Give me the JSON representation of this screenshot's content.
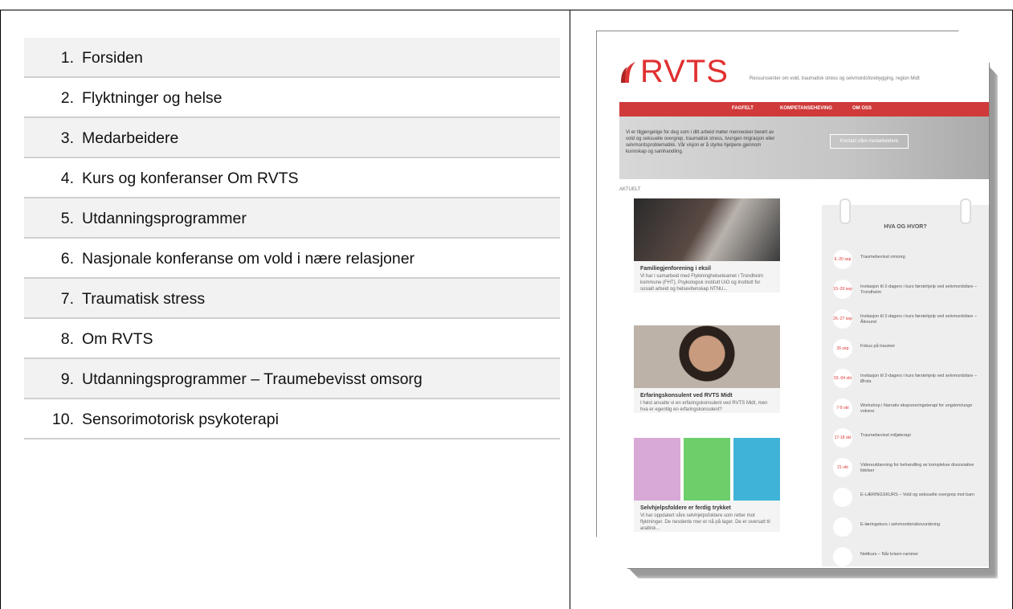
{
  "list": [
    {
      "num": "1.",
      "label": "Forsiden",
      "shade": true
    },
    {
      "num": "2.",
      "label": "Flyktninger og helse",
      "shade": false
    },
    {
      "num": "3.",
      "label": "Medarbeidere",
      "shade": true
    },
    {
      "num": "4.",
      "label": "Kurs og konferanser Om RVTS",
      "shade": false
    },
    {
      "num": "5.",
      "label": "Utdanningsprogrammer",
      "shade": true
    },
    {
      "num": "6.",
      "label": "Nasjonale konferanse om vold i nære relasjoner",
      "shade": false
    },
    {
      "num": "7.",
      "label": "Traumatisk stress",
      "shade": true
    },
    {
      "num": "8.",
      "label": "Om RVTS",
      "shade": false
    },
    {
      "num": "9.",
      "label": "Utdanningsprogrammer – Traumebevisst omsorg",
      "shade": true
    },
    {
      "num": "10.",
      "label": "Sensorimotorisk psykoterapi",
      "shade": false
    }
  ],
  "thumb": {
    "logo": "RVTS",
    "tagline": "Ressurssenter om vold, traumatisk stress og selvmordsforebygging, region Midt",
    "nav": [
      "FAGFELT",
      "KOMPETANSEHEVING",
      "OM OSS"
    ],
    "hero_text": "Vi er tilgjengelige for deg som i ditt arbeid møter mennesker berørt av vold og seksuelle overgrep, traumatisk stress, tvungen migrasjon eller selvmordsproblematikk. Vår visjon er å styrke hjelpere gjennom kunnskap og samhandling.",
    "hero_button": "Kontakt våre medarbeidere",
    "section": "AKTUELT",
    "cards": [
      {
        "title": "Familiegjenforening i eksil",
        "body": "Vi har i samarbeid med Flyktninghelseteamet i Trondheim kommune (FHT), Psykologisk institutt UiO og Institutt for sosialt arbeid og helsevitenskap NTNU..."
      },
      {
        "title": "Erfaringskonsulent ved RVTS Midt",
        "body": "I høst ansatte vi en erfaringskonsulent ved RVTS Midt, men hva er egentlig en erfaringskonsulent?"
      },
      {
        "title": "Selvhjelpsfoldere er ferdig trykket",
        "body": "Vi har oppdatert våre selvhjelpsfoldere som retter mot flyktninger. De nesdente mer er nå på lager. De er oversatt til arabisk..."
      }
    ],
    "cal_title": "HVA OG HVOR?",
    "events": [
      {
        "date": "6.-20 sep",
        "text": "Traumebevisst omsorg"
      },
      {
        "date": "19.-20 sep",
        "text": "Invitasjon til 2-dagers i kurs førstehjelp ved selvmordsfare – Trondheim"
      },
      {
        "date": "26.-27 sep",
        "text": "Invitasjon til 2-dagers i kurs førstehjelp ved selvmordsfare – Ålesund"
      },
      {
        "date": "26 sep",
        "text": "Fokus på traumer"
      },
      {
        "date": "03.-04 okt",
        "text": "Invitasjon til 2-dagers i kurs førstehjelp ved selvmordsfare – Ørsta"
      },
      {
        "date": "7-9 okt",
        "text": "Workshop i Narrativ eksponeringsterapi for ungdom/unge voksne"
      },
      {
        "date": "17-18 okt",
        "text": "Traumebevisst miljøterapi"
      },
      {
        "date": "21 okt",
        "text": "Videreutdanning for behandling av komplekse dissosiative lidelser"
      },
      {
        "date": "",
        "text": "E-LÆRINGSKURS – Vold og seksuelle overgrep mot barn"
      },
      {
        "date": "",
        "text": "E-læringskurs i selvmordsrisikovurdering"
      },
      {
        "date": "",
        "text": "Nettkurs – Når krisen rammer"
      }
    ]
  }
}
